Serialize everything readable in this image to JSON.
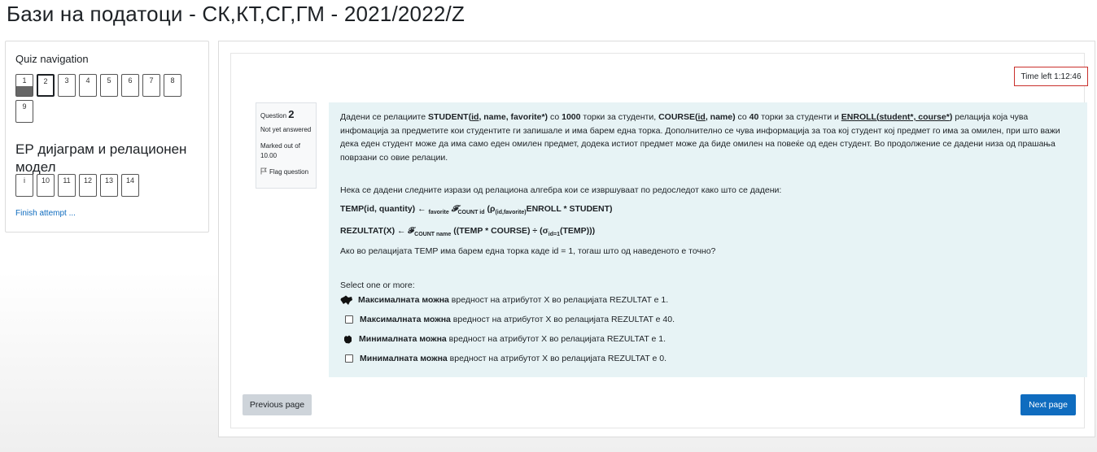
{
  "page": {
    "title": "Бази на податоци - СК,КТ,СГ,ГМ - 2021/2022/Z"
  },
  "quiz_nav": {
    "title": "Quiz navigation",
    "row1": [
      {
        "label": "1",
        "state": "answered"
      },
      {
        "label": "2",
        "state": "current"
      },
      {
        "label": "3",
        "state": ""
      },
      {
        "label": "4",
        "state": ""
      },
      {
        "label": "5",
        "state": ""
      },
      {
        "label": "6",
        "state": ""
      },
      {
        "label": "7",
        "state": ""
      },
      {
        "label": "8",
        "state": ""
      },
      {
        "label": "9",
        "state": ""
      }
    ],
    "section_title": "ЕР дијаграм и релационен модел",
    "row2": [
      {
        "label": "i"
      },
      {
        "label": "10"
      },
      {
        "label": "11"
      },
      {
        "label": "12"
      },
      {
        "label": "13"
      },
      {
        "label": "14"
      }
    ],
    "finish_link": "Finish attempt ..."
  },
  "timer": {
    "text": "Time left 1:12:46"
  },
  "question_info": {
    "question_label": "Question",
    "question_number": "2",
    "state": "Not yet answered",
    "grade": "Marked out of 10.00",
    "flag": "Flag question"
  },
  "question": {
    "p1": {
      "t1": "Дадени се релациите ",
      "student": "STUDENT(",
      "id": "id",
      "student_rest": ", name, favorite*)",
      "t2": " со ",
      "n1000": "1000",
      "t3": " торки за студенти, ",
      "course": "COURSE(",
      "course_rest": ", name)",
      "t4": " со ",
      "n40": "40",
      "t5": " торки за студенти и ",
      "enroll": "ENROLL(",
      "enroll_key": "student*, course*",
      "enroll_close": ")",
      "t6": " релација која чува инфомација за предметите кои студентите ги запишале и има барем една торка. Дополнително се чува информација за тоа кој студент кој предмет го има за омилен, при што важи дека еден студент може да има само еден омилен предмет, додека истиот предмет може да биде омилен на повеќе од еден студент. Во продолжение се дадени низа од прашања поврзани со овие релации."
    },
    "p2": "Нека се дадени следните изрази од релациона алгебра кои се извршуваат по редоследот како што се дадени:",
    "f1": {
      "a": "TEMP(id, quantity) ← ",
      "b": "favorite",
      "c": " 𝓕",
      "d": "COUNT id",
      "e": " (ρ",
      "f": "(id,favorite)",
      "g": "ENROLL * STUDENT)"
    },
    "f2": {
      "a": "REZULTAT(X) ← 𝓕",
      "b": "COUNT name",
      "c": " ((TEMP * COURSE) ÷ (σ",
      "d": "id=1",
      "e": "(TEMP)))"
    },
    "p3": "Ако во релацијата TEMP има барем една торка каде id = 1, тогаш што од наведеното е точно?",
    "select_prompt": "Select one or more:",
    "options": [
      {
        "bold": "Максималната можна",
        "rest": " вредност на атрибутот X во релацијата REZULTAT е 1.",
        "mark": "blob"
      },
      {
        "bold": "Максималната можна",
        "rest": " вредност на атрибутот X во релацијата REZULTAT е 40.",
        "mark": "box"
      },
      {
        "bold": "Минималната можна",
        "rest": " вредност на атрибутот X во релацијата REZULTAT е 1.",
        "mark": "blob"
      },
      {
        "bold": "Минималната можна",
        "rest": " вредност на атрибутот X во релацијата REZULTAT е 0.",
        "mark": "box"
      }
    ]
  },
  "nav_buttons": {
    "prev": "Previous page",
    "next": "Next page"
  }
}
